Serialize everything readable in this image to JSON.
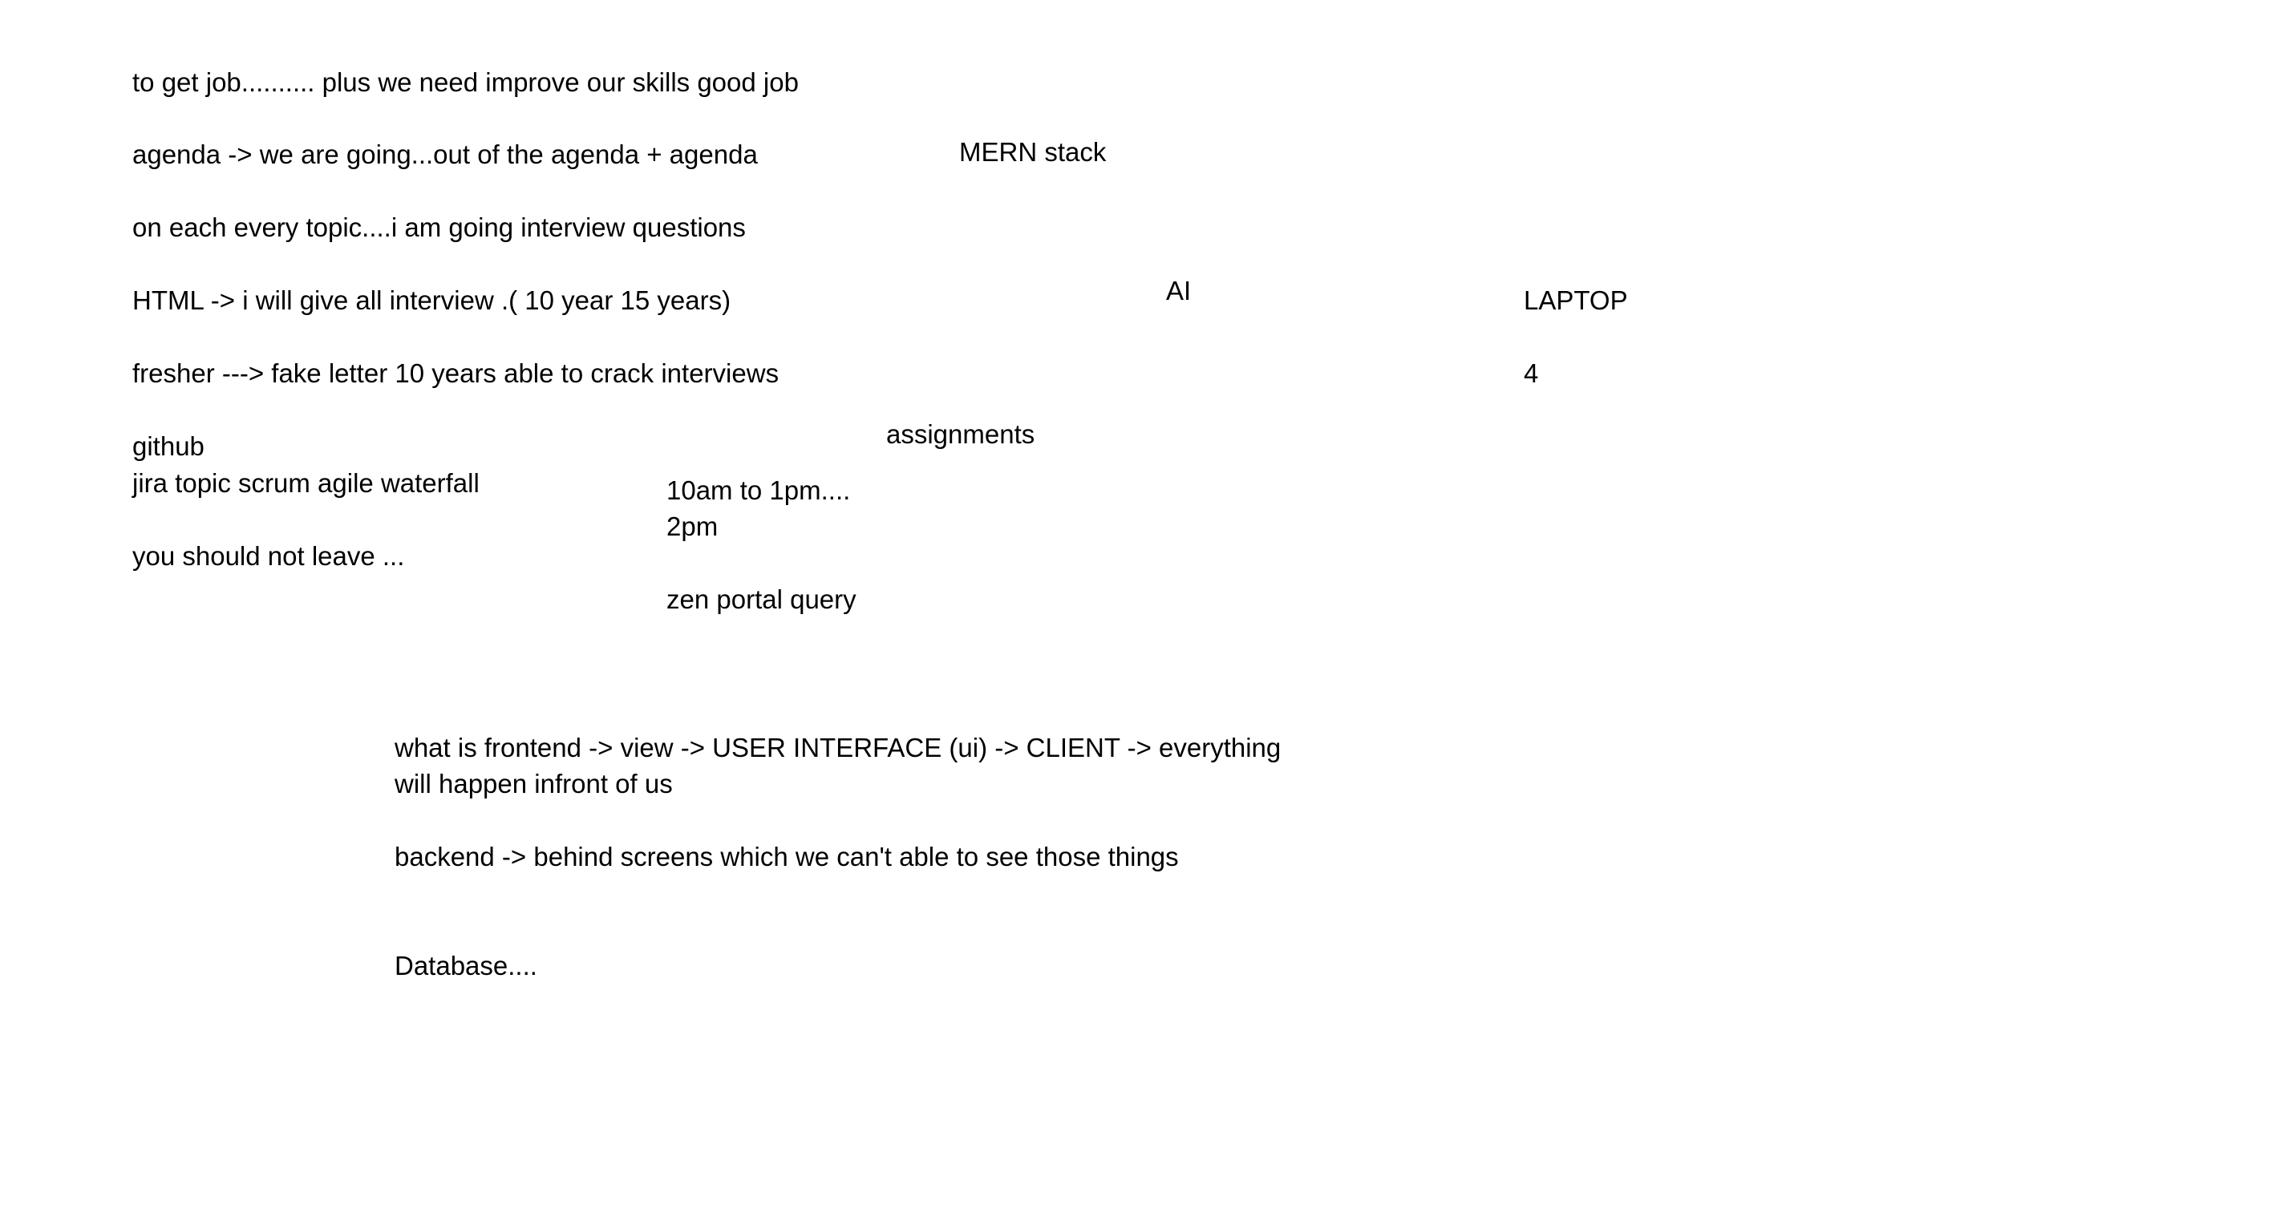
{
  "notes": {
    "line_01": "to get job.......... plus we need improve our skills good job",
    "line_02": "agenda -> we are going...out of the agenda + agenda",
    "line_03": "on each every topic....i am going interview questions",
    "line_04": "HTML -> i will give all interview .( 10 year 15 years)",
    "line_05": "fresher ---> fake letter 10 years able to crack interviews",
    "line_06": "github",
    "line_07": "jira topic scrum agile waterfall",
    "line_08": "you should not leave ...",
    "mern_stack": "MERN stack",
    "ai": "AI",
    "laptop": "LAPTOP",
    "four": "4",
    "assignments": "assignments",
    "time_1": "10am to 1pm....",
    "time_2": "2pm",
    "zen_portal": "zen portal query",
    "frontend_1": "what is frontend -> view -> USER INTERFACE (ui) -> CLIENT -> everything",
    "frontend_2": "will happen infront of us",
    "backend": "backend -> behind screens which we can't able to see those things",
    "database": "Database...."
  },
  "colors": {
    "background": "#ffffff",
    "text": "#000000"
  }
}
